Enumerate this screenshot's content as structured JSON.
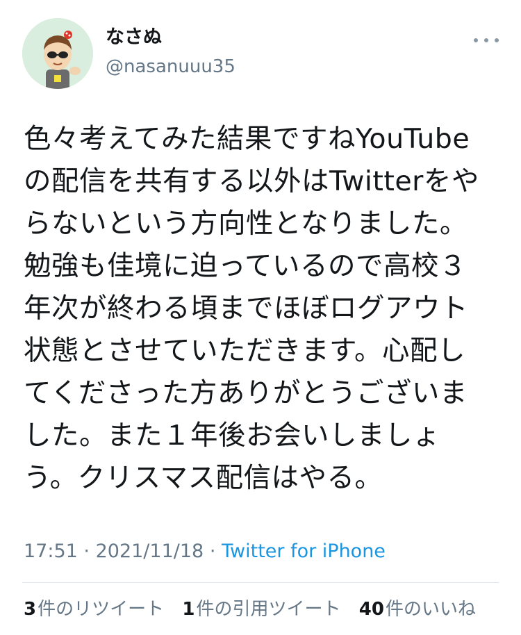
{
  "user": {
    "display_name": "なさぬ",
    "handle": "@nasanuuu35"
  },
  "more_icon": "more-horizontal-icon",
  "tweet": {
    "lines": [
      "色々考えてみた結果ですねYouTube",
      "の配信を共有する以外はTwitterをや",
      "らないという方向性となりました。",
      "勉強も佳境に迫っているので高校３",
      "年次が終わる頃までほぼログアウト",
      "状態とさせていただきます。心配し",
      "てくださった方ありがとうございま",
      "した。また１年後お会いしましょ",
      "う。クリスマス配信はやる。"
    ]
  },
  "meta": {
    "time": "17:51",
    "sep1": "·",
    "date": "2021/11/18",
    "sep2": "·",
    "source": "Twitter for iPhone"
  },
  "stats": {
    "retweets_count": "3",
    "retweets_label": "件のリツイート",
    "quotes_count": "1",
    "quotes_label": "件の引用ツイート",
    "likes_count": "40",
    "likes_label": "件のいいね"
  },
  "colors": {
    "text": "#14171a",
    "secondary": "#657786",
    "link": "#1b95e0",
    "divider": "#e1e8ed"
  }
}
